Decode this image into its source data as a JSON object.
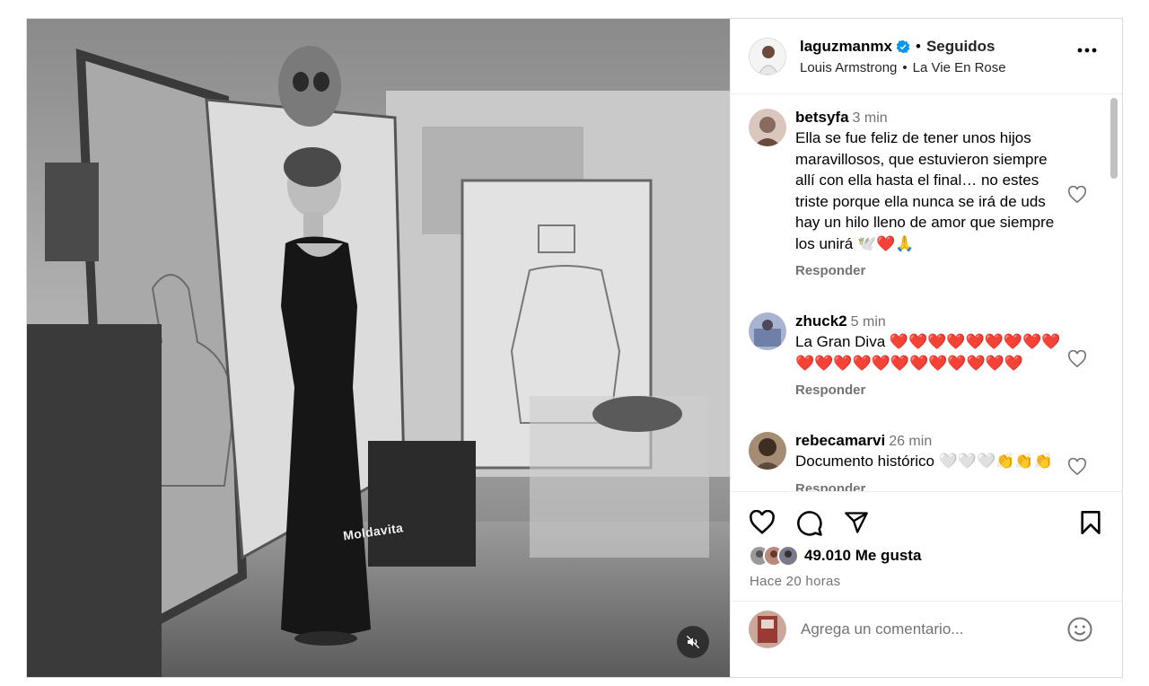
{
  "post": {
    "media": {
      "watermark": "Moldavita",
      "mute_icon": "speaker-muted-icon"
    },
    "header": {
      "username": "laguzmanmx",
      "verified_icon": "verified-badge-icon",
      "dot": "•",
      "follow_status": "Seguidos",
      "audio_artist": "Louis Armstrong",
      "audio_sep": "•",
      "audio_title": "La Vie En Rose",
      "more_icon": "more-horizontal-icon"
    },
    "comments": [
      {
        "username": "betsyfa",
        "time": "3 min",
        "text": "Ella se fue feliz de tener unos hijos maravillosos, que estuvieron siempre allí con ella hasta el final… no estes triste porque ella nunca se irá de uds hay un hilo lleno de amor que siempre los unirá 🕊️❤️🙏",
        "reply_label": "Responder",
        "avatar_color": "#8a6a5c"
      },
      {
        "username": "zhuck2",
        "time": "5 min",
        "text": "La Gran Diva ❤️❤️❤️❤️❤️❤️❤️❤️❤️ ❤️❤️❤️❤️❤️❤️❤️❤️❤️❤️❤️❤️",
        "reply_label": "Responder",
        "avatar_color": "#6f7fa6"
      },
      {
        "username": "rebecamarvi",
        "time": "26 min",
        "text": "Documento histórico 🤍🤍🤍👏👏👏",
        "reply_label": "Responder",
        "avatar_color": "#5e4a3a"
      }
    ],
    "actions": {
      "like_icon": "heart-icon",
      "comment_icon": "comment-icon",
      "share_icon": "share-paper-plane-icon",
      "save_icon": "bookmark-icon",
      "likes": "49.010 Me gusta",
      "time_ago": "Hace 20 horas"
    },
    "comment_box": {
      "placeholder": "Agrega un comentario...",
      "emoji_icon": "emoji-smile-icon"
    }
  }
}
